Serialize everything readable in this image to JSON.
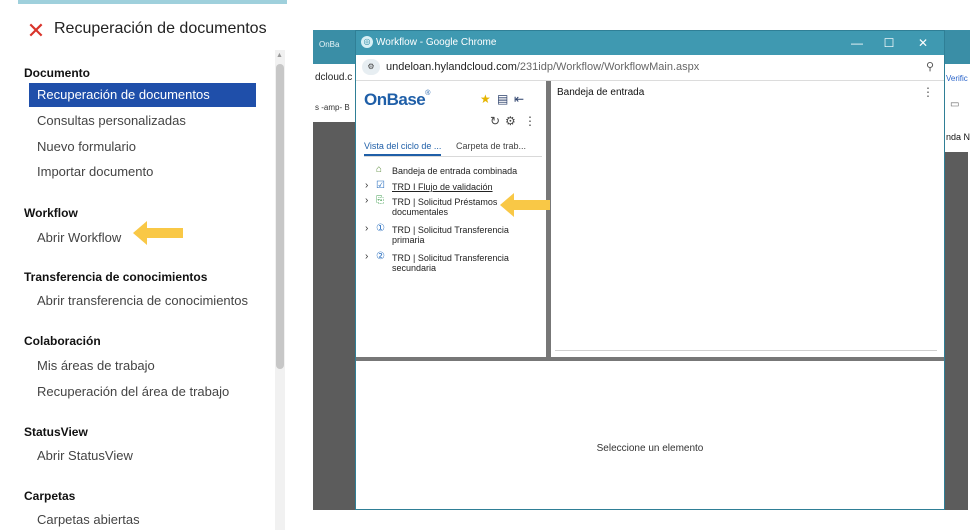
{
  "left_panel": {
    "title": "Recuperación de documentos",
    "sections": [
      {
        "heading": "Documento",
        "items": [
          "Recuperación de documentos",
          "Consultas personalizadas",
          "Nuevo formulario",
          "Importar documento"
        ]
      },
      {
        "heading": "Workflow",
        "items": [
          "Abrir Workflow"
        ]
      },
      {
        "heading": "Transferencia de conocimientos",
        "items": [
          "Abrir transferencia de conocimientos"
        ]
      },
      {
        "heading": "Colaboración",
        "items": [
          "Mis áreas de trabajo",
          "Recuperación del área de trabajo"
        ]
      },
      {
        "heading": "StatusView",
        "items": [
          "Abrir StatusView"
        ]
      },
      {
        "heading": "Carpetas",
        "items": [
          "Carpetas abiertas"
        ]
      }
    ],
    "active_item": "Recuperación de documentos"
  },
  "background_window": {
    "tab_label": "OnBa",
    "url_fragment": "dcloud.c",
    "bookmark_fragment": "s -amp- B",
    "right_url_fragment": "Verific",
    "right_content_fragment": "nda N"
  },
  "chrome": {
    "window_title": "Workflow - Google Chrome",
    "url_host": "undeloan.hylandcloud.com",
    "url_path": "/231idp/Workflow/WorkflowMain.aspx",
    "controls": {
      "minimize": "—",
      "maximize": "☐",
      "close": "✕"
    }
  },
  "onbase": {
    "logo": "OnBase",
    "logo_mark": "®",
    "tabs": [
      "Vista del ciclo de ...",
      "Carpeta de trab..."
    ],
    "tree": [
      {
        "label": "Bandeja de entrada combinada",
        "icon": "inbox-icon",
        "expandable": false
      },
      {
        "label": "TRD I Flujo de validación",
        "icon": "checklist-icon",
        "expandable": true
      },
      {
        "label": "TRD | Solicitud Préstamos documentales",
        "lines": [
          "TRD | Solicitud Préstamos",
          "documentales"
        ],
        "icon": "document-share-icon",
        "expandable": true
      },
      {
        "label": "TRD | Solicitud Transferencia primaria",
        "lines": [
          "TRD | Solicitud Transferencia",
          "primaria"
        ],
        "icon": "number-1-icon",
        "expandable": true
      },
      {
        "label": "TRD | Solicitud Transferencia secundaria",
        "lines": [
          "TRD | Solicitud Transferencia",
          "secundaria"
        ],
        "icon": "number-2-icon",
        "expandable": true
      }
    ],
    "inbox_title": "Bandeja de entrada",
    "detail_placeholder": "Seleccione un elemento"
  },
  "colors": {
    "accent_blue": "#1f4faa",
    "chrome_teal": "#3f99b1",
    "close_red": "#d9342b",
    "arrow_yellow": "#f9c846"
  }
}
